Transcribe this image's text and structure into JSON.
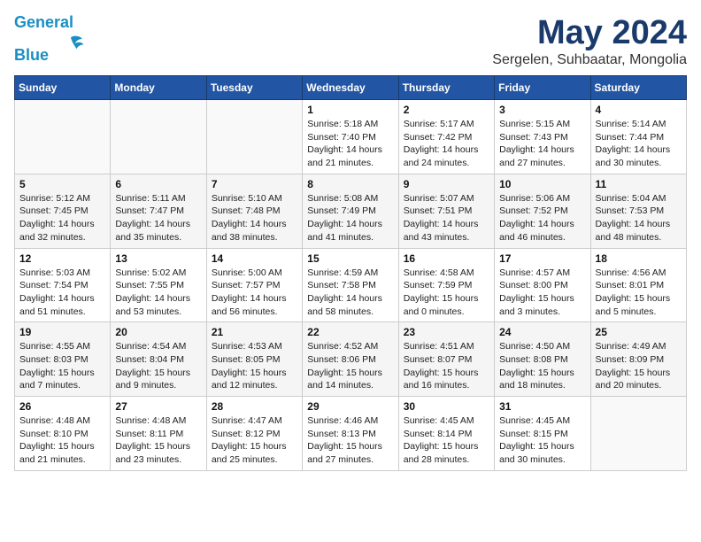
{
  "header": {
    "logo_line1": "General",
    "logo_line2": "Blue",
    "month": "May 2024",
    "location": "Sergelen, Suhbaatar, Mongolia"
  },
  "weekdays": [
    "Sunday",
    "Monday",
    "Tuesday",
    "Wednesday",
    "Thursday",
    "Friday",
    "Saturday"
  ],
  "weeks": [
    [
      {
        "day": "",
        "info": ""
      },
      {
        "day": "",
        "info": ""
      },
      {
        "day": "",
        "info": ""
      },
      {
        "day": "1",
        "info": "Sunrise: 5:18 AM\nSunset: 7:40 PM\nDaylight: 14 hours\nand 21 minutes."
      },
      {
        "day": "2",
        "info": "Sunrise: 5:17 AM\nSunset: 7:42 PM\nDaylight: 14 hours\nand 24 minutes."
      },
      {
        "day": "3",
        "info": "Sunrise: 5:15 AM\nSunset: 7:43 PM\nDaylight: 14 hours\nand 27 minutes."
      },
      {
        "day": "4",
        "info": "Sunrise: 5:14 AM\nSunset: 7:44 PM\nDaylight: 14 hours\nand 30 minutes."
      }
    ],
    [
      {
        "day": "5",
        "info": "Sunrise: 5:12 AM\nSunset: 7:45 PM\nDaylight: 14 hours\nand 32 minutes."
      },
      {
        "day": "6",
        "info": "Sunrise: 5:11 AM\nSunset: 7:47 PM\nDaylight: 14 hours\nand 35 minutes."
      },
      {
        "day": "7",
        "info": "Sunrise: 5:10 AM\nSunset: 7:48 PM\nDaylight: 14 hours\nand 38 minutes."
      },
      {
        "day": "8",
        "info": "Sunrise: 5:08 AM\nSunset: 7:49 PM\nDaylight: 14 hours\nand 41 minutes."
      },
      {
        "day": "9",
        "info": "Sunrise: 5:07 AM\nSunset: 7:51 PM\nDaylight: 14 hours\nand 43 minutes."
      },
      {
        "day": "10",
        "info": "Sunrise: 5:06 AM\nSunset: 7:52 PM\nDaylight: 14 hours\nand 46 minutes."
      },
      {
        "day": "11",
        "info": "Sunrise: 5:04 AM\nSunset: 7:53 PM\nDaylight: 14 hours\nand 48 minutes."
      }
    ],
    [
      {
        "day": "12",
        "info": "Sunrise: 5:03 AM\nSunset: 7:54 PM\nDaylight: 14 hours\nand 51 minutes."
      },
      {
        "day": "13",
        "info": "Sunrise: 5:02 AM\nSunset: 7:55 PM\nDaylight: 14 hours\nand 53 minutes."
      },
      {
        "day": "14",
        "info": "Sunrise: 5:00 AM\nSunset: 7:57 PM\nDaylight: 14 hours\nand 56 minutes."
      },
      {
        "day": "15",
        "info": "Sunrise: 4:59 AM\nSunset: 7:58 PM\nDaylight: 14 hours\nand 58 minutes."
      },
      {
        "day": "16",
        "info": "Sunrise: 4:58 AM\nSunset: 7:59 PM\nDaylight: 15 hours\nand 0 minutes."
      },
      {
        "day": "17",
        "info": "Sunrise: 4:57 AM\nSunset: 8:00 PM\nDaylight: 15 hours\nand 3 minutes."
      },
      {
        "day": "18",
        "info": "Sunrise: 4:56 AM\nSunset: 8:01 PM\nDaylight: 15 hours\nand 5 minutes."
      }
    ],
    [
      {
        "day": "19",
        "info": "Sunrise: 4:55 AM\nSunset: 8:03 PM\nDaylight: 15 hours\nand 7 minutes."
      },
      {
        "day": "20",
        "info": "Sunrise: 4:54 AM\nSunset: 8:04 PM\nDaylight: 15 hours\nand 9 minutes."
      },
      {
        "day": "21",
        "info": "Sunrise: 4:53 AM\nSunset: 8:05 PM\nDaylight: 15 hours\nand 12 minutes."
      },
      {
        "day": "22",
        "info": "Sunrise: 4:52 AM\nSunset: 8:06 PM\nDaylight: 15 hours\nand 14 minutes."
      },
      {
        "day": "23",
        "info": "Sunrise: 4:51 AM\nSunset: 8:07 PM\nDaylight: 15 hours\nand 16 minutes."
      },
      {
        "day": "24",
        "info": "Sunrise: 4:50 AM\nSunset: 8:08 PM\nDaylight: 15 hours\nand 18 minutes."
      },
      {
        "day": "25",
        "info": "Sunrise: 4:49 AM\nSunset: 8:09 PM\nDaylight: 15 hours\nand 20 minutes."
      }
    ],
    [
      {
        "day": "26",
        "info": "Sunrise: 4:48 AM\nSunset: 8:10 PM\nDaylight: 15 hours\nand 21 minutes."
      },
      {
        "day": "27",
        "info": "Sunrise: 4:48 AM\nSunset: 8:11 PM\nDaylight: 15 hours\nand 23 minutes."
      },
      {
        "day": "28",
        "info": "Sunrise: 4:47 AM\nSunset: 8:12 PM\nDaylight: 15 hours\nand 25 minutes."
      },
      {
        "day": "29",
        "info": "Sunrise: 4:46 AM\nSunset: 8:13 PM\nDaylight: 15 hours\nand 27 minutes."
      },
      {
        "day": "30",
        "info": "Sunrise: 4:45 AM\nSunset: 8:14 PM\nDaylight: 15 hours\nand 28 minutes."
      },
      {
        "day": "31",
        "info": "Sunrise: 4:45 AM\nSunset: 8:15 PM\nDaylight: 15 hours\nand 30 minutes."
      },
      {
        "day": "",
        "info": ""
      }
    ]
  ]
}
